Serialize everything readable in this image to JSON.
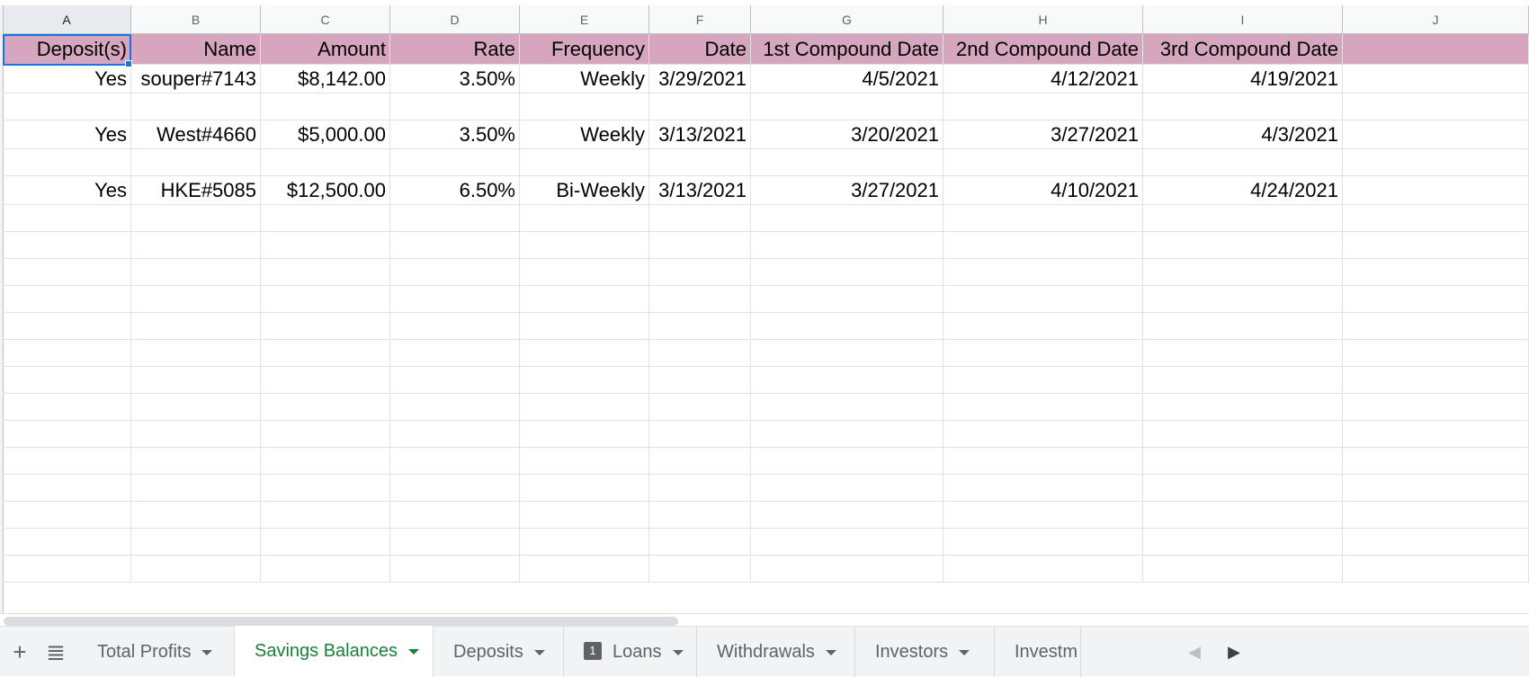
{
  "columns": [
    "A",
    "B",
    "C",
    "D",
    "E",
    "F",
    "G",
    "H",
    "I",
    "J"
  ],
  "header_row": [
    "Deposit(s)",
    "Name",
    "Amount",
    "Rate",
    "Frequency",
    "Date",
    "1st Compound Date",
    "2nd Compound Date",
    "3rd Compound Date",
    ""
  ],
  "rows": [
    [
      "Yes",
      "souper#7143",
      "$8,142.00",
      "3.50%",
      "Weekly",
      "3/29/2021",
      "4/5/2021",
      "4/12/2021",
      "4/19/2021",
      ""
    ],
    [
      "",
      "",
      "",
      "",
      "",
      "",
      "",
      "",
      "",
      ""
    ],
    [
      "Yes",
      "West#4660",
      "$5,000.00",
      "3.50%",
      "Weekly",
      "3/13/2021",
      "3/20/2021",
      "3/27/2021",
      "4/3/2021",
      ""
    ],
    [
      "",
      "",
      "",
      "",
      "",
      "",
      "",
      "",
      "",
      ""
    ],
    [
      "Yes",
      "HKE#5085",
      "$12,500.00",
      "6.50%",
      "Bi-Weekly",
      "3/13/2021",
      "3/27/2021",
      "4/10/2021",
      "4/24/2021",
      ""
    ],
    [
      "",
      "",
      "",
      "",
      "",
      "",
      "",
      "",
      "",
      ""
    ],
    [
      "",
      "",
      "",
      "",
      "",
      "",
      "",
      "",
      "",
      ""
    ],
    [
      "",
      "",
      "",
      "",
      "",
      "",
      "",
      "",
      "",
      ""
    ],
    [
      "",
      "",
      "",
      "",
      "",
      "",
      "",
      "",
      "",
      ""
    ],
    [
      "",
      "",
      "",
      "",
      "",
      "",
      "",
      "",
      "",
      ""
    ],
    [
      "",
      "",
      "",
      "",
      "",
      "",
      "",
      "",
      "",
      ""
    ],
    [
      "",
      "",
      "",
      "",
      "",
      "",
      "",
      "",
      "",
      ""
    ],
    [
      "",
      "",
      "",
      "",
      "",
      "",
      "",
      "",
      "",
      ""
    ],
    [
      "",
      "",
      "",
      "",
      "",
      "",
      "",
      "",
      "",
      ""
    ],
    [
      "",
      "",
      "",
      "",
      "",
      "",
      "",
      "",
      "",
      ""
    ],
    [
      "",
      "",
      "",
      "",
      "",
      "",
      "",
      "",
      "",
      ""
    ],
    [
      "",
      "",
      "",
      "",
      "",
      "",
      "",
      "",
      "",
      ""
    ],
    [
      "",
      "",
      "",
      "",
      "",
      "",
      "",
      "",
      "",
      ""
    ],
    [
      "",
      "",
      "",
      "",
      "",
      "",
      "",
      "",
      "",
      ""
    ]
  ],
  "selected_column": "A",
  "header_fill": "#d5a6bd",
  "tabs": [
    {
      "label": "Total Profits",
      "active": false,
      "badge": ""
    },
    {
      "label": "Savings Balances",
      "active": true,
      "badge": ""
    },
    {
      "label": "Deposits",
      "active": false,
      "badge": ""
    },
    {
      "label": "Loans",
      "active": false,
      "badge": "1"
    },
    {
      "label": "Withdrawals",
      "active": false,
      "badge": ""
    },
    {
      "label": "Investors",
      "active": false,
      "badge": ""
    },
    {
      "label": "Investm",
      "active": false,
      "badge": ""
    }
  ],
  "toolbar": {
    "add_sheet_icon": "plus-icon",
    "all_sheets_icon": "list-icon",
    "scroll_left_icon": "chevron-left-icon",
    "scroll_right_icon": "chevron-right-icon"
  },
  "accent_color": "#188038"
}
